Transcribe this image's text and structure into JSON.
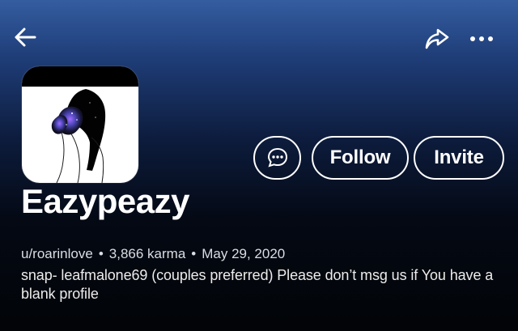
{
  "header": {
    "back_icon": "arrow-left-icon",
    "share_icon": "share-icon",
    "more_icon": "more-horizontal-icon"
  },
  "profile": {
    "display_name": "Eazypeazy",
    "username": "u/roarinlove",
    "karma": "3,866 karma",
    "joined_date": "May 29, 2020",
    "separator": "•",
    "bio": "snap- leafmalone69 (couples preferred)  Please don’t msg us if You have a blank profile",
    "avatar_description": "couple-silhouette-artwork"
  },
  "actions": {
    "chat_icon": "chat-icon",
    "follow_label": "Follow",
    "invite_label": "Invite"
  },
  "theme": {
    "top_blue": "#345da0",
    "mid_blue": "#1e3c76",
    "dark_bg": "#020407",
    "text": "#ffffff"
  }
}
